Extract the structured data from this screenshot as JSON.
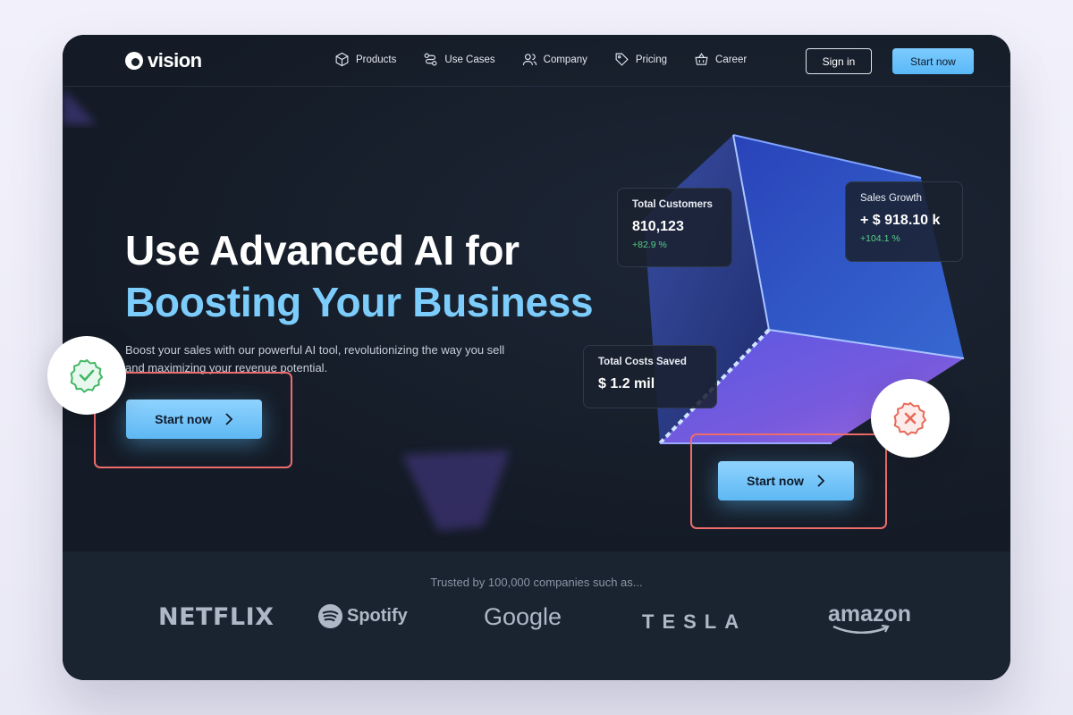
{
  "brand": {
    "name": "vision"
  },
  "nav": {
    "items": [
      {
        "label": "Products",
        "icon": "box-icon"
      },
      {
        "label": "Use Cases",
        "icon": "route-icon"
      },
      {
        "label": "Company",
        "icon": "users-icon"
      },
      {
        "label": "Pricing",
        "icon": "tag-icon"
      },
      {
        "label": "Career",
        "icon": "basket-icon"
      }
    ],
    "signin": "Sign in",
    "start": "Start now"
  },
  "hero": {
    "title_line1": "Use Advanced AI for",
    "title_line2": "Boosting Your Business",
    "subtitle": "Boost your sales with our powerful AI tool, revolutionizing the way you sell and maximizing your revenue potential.",
    "cta": "Start now",
    "cta_alt": "Start now"
  },
  "stats": {
    "customers": {
      "label": "Total Customers",
      "value": "810,123",
      "delta": "+82.9 %"
    },
    "growth": {
      "label": "Sales Growth",
      "value": "+ $ 918.10 k",
      "delta": "+104.1 %"
    },
    "costs": {
      "label": "Total Costs Saved",
      "value": "$ 1.2 mil"
    }
  },
  "trust": {
    "text": "Trusted by 100,000 companies such as...",
    "logos": [
      "NETFLIX",
      "Spotify",
      "Google",
      "TESLA",
      "amazon"
    ]
  },
  "colors": {
    "accent": "#7ccdfb",
    "success": "#54d087",
    "highlight": "#ef6c6c",
    "background": "#171f2b"
  }
}
